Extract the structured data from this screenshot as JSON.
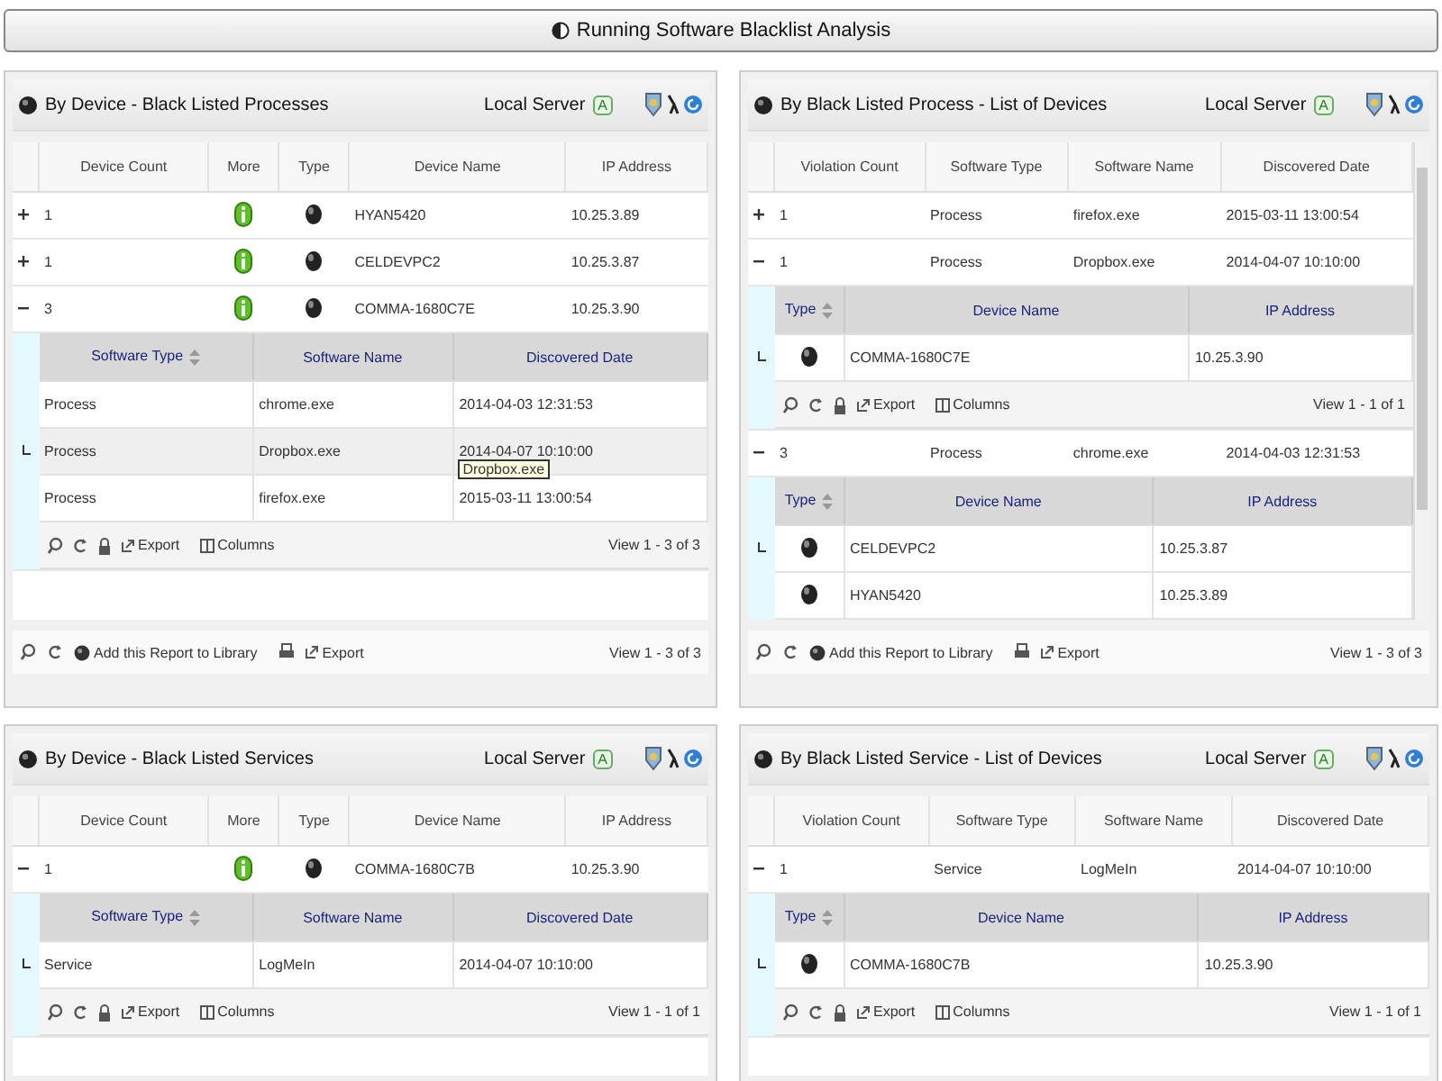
{
  "header": {
    "title": "Running Software Blacklist Analysis"
  },
  "panels": [
    {
      "title": "By Device - Black Listed Processes",
      "server": "Local Server",
      "server_badge": "A",
      "scrollable": false,
      "columns": [
        {
          "label": "Device Count",
          "kind": "text"
        },
        {
          "label": "More",
          "kind": "info"
        },
        {
          "label": "Type",
          "kind": "device"
        },
        {
          "label": "Device Name",
          "kind": "text"
        },
        {
          "label": "IP Address",
          "kind": "text"
        }
      ],
      "rows": [
        {
          "expanded": false,
          "cells": [
            "1",
            "",
            "",
            "HYAN5420",
            "10.25.3.89"
          ]
        },
        {
          "expanded": false,
          "cells": [
            "1",
            "",
            "",
            "CELDEVPC2",
            "10.25.3.87"
          ]
        },
        {
          "expanded": true,
          "cells": [
            "3",
            "",
            "",
            "COMMA-1680C7E",
            "10.25.3.90"
          ],
          "subgrid": {
            "columns": [
              {
                "label": "Software Type",
                "kind": "text",
                "sorted": true
              },
              {
                "label": "Software Name",
                "kind": "text",
                "sorted": false
              },
              {
                "label": "Discovered Date",
                "kind": "text",
                "sorted": false
              }
            ],
            "rows": [
              {
                "hovered": false,
                "cells": [
                  "Process",
                  "chrome.exe",
                  "2014-04-03 12:31:53"
                ]
              },
              {
                "hovered": true,
                "tooltip": "Dropbox.exe",
                "cells": [
                  "Process",
                  "Dropbox.exe",
                  "2014-04-07 10:10:00"
                ]
              },
              {
                "hovered": false,
                "cells": [
                  "Process",
                  "firefox.exe",
                  "2015-03-11 13:00:54"
                ]
              }
            ],
            "footer": {
              "export": "Export",
              "columns": "Columns",
              "pager": "View 1 - 3 of 3"
            }
          }
        }
      ],
      "footer": {
        "add": "Add this Report to Library",
        "export": "Export",
        "pager": "View 1 - 3 of 3"
      }
    },
    {
      "title": "By Black Listed Process - List of Devices",
      "server": "Local Server",
      "server_badge": "A",
      "scrollable": true,
      "columns": [
        {
          "label": "Violation Count",
          "kind": "text"
        },
        {
          "label": "Software Type",
          "kind": "text"
        },
        {
          "label": "Software Name",
          "kind": "text"
        },
        {
          "label": "Discovered Date",
          "kind": "text"
        }
      ],
      "rows": [
        {
          "expanded": false,
          "cells": [
            "1",
            "Process",
            "firefox.exe",
            "2015-03-11 13:00:54"
          ]
        },
        {
          "expanded": true,
          "cells": [
            "1",
            "Process",
            "Dropbox.exe",
            "2014-04-07 10:10:00"
          ],
          "subgrid": {
            "columns": [
              {
                "label": "Type",
                "kind": "device",
                "sorted": true
              },
              {
                "label": "Device Name",
                "kind": "text",
                "sorted": false
              },
              {
                "label": "IP Address",
                "kind": "text",
                "sorted": false
              }
            ],
            "rows": [
              {
                "hovered": false,
                "cells": [
                  "",
                  "COMMA-1680C7E",
                  "10.25.3.90"
                ]
              }
            ],
            "footer": {
              "export": "Export",
              "columns": "Columns",
              "pager": "View 1 - 1 of 1"
            }
          }
        },
        {
          "expanded": true,
          "cells": [
            "3",
            "Process",
            "chrome.exe",
            "2014-04-03 12:31:53"
          ],
          "subgrid": {
            "columns": [
              {
                "label": "Type",
                "kind": "device",
                "sorted": true
              },
              {
                "label": "Device Name",
                "kind": "text",
                "sorted": false
              },
              {
                "label": "IP Address",
                "kind": "text",
                "sorted": false
              }
            ],
            "rows": [
              {
                "hovered": false,
                "cells": [
                  "",
                  "CELDEVPC2",
                  "10.25.3.87"
                ]
              },
              {
                "hovered": false,
                "cells": [
                  "",
                  "HYAN5420",
                  "10.25.3.89"
                ]
              }
            ]
          }
        }
      ],
      "footer": {
        "add": "Add this Report to Library",
        "export": "Export",
        "pager": "View 1 - 3 of 3"
      }
    },
    {
      "title": "By Device - Black Listed Services",
      "server": "Local Server",
      "server_badge": "A",
      "scrollable": false,
      "columns": [
        {
          "label": "Device Count",
          "kind": "text"
        },
        {
          "label": "More",
          "kind": "info"
        },
        {
          "label": "Type",
          "kind": "device"
        },
        {
          "label": "Device Name",
          "kind": "text"
        },
        {
          "label": "IP Address",
          "kind": "text"
        }
      ],
      "rows": [
        {
          "expanded": true,
          "cells": [
            "1",
            "",
            "",
            "COMMA-1680C7B",
            "10.25.3.90"
          ],
          "subgrid": {
            "columns": [
              {
                "label": "Software Type",
                "kind": "text",
                "sorted": true
              },
              {
                "label": "Software Name",
                "kind": "text",
                "sorted": false
              },
              {
                "label": "Discovered Date",
                "kind": "text",
                "sorted": false
              }
            ],
            "rows": [
              {
                "hovered": false,
                "cells": [
                  "Service",
                  "LogMeIn",
                  "2014-04-07 10:10:00"
                ]
              }
            ],
            "footer": {
              "export": "Export",
              "columns": "Columns",
              "pager": "View 1 - 1 of 1"
            }
          }
        }
      ]
    },
    {
      "title": "By Black Listed Service - List of Devices",
      "server": "Local Server",
      "server_badge": "A",
      "scrollable": false,
      "columns": [
        {
          "label": "Violation Count",
          "kind": "text"
        },
        {
          "label": "Software Type",
          "kind": "text"
        },
        {
          "label": "Software Name",
          "kind": "text"
        },
        {
          "label": "Discovered Date",
          "kind": "text"
        }
      ],
      "rows": [
        {
          "expanded": true,
          "cells": [
            "1",
            "Service",
            "LogMeIn",
            "2014-04-07 10:10:00"
          ],
          "subgrid": {
            "columns": [
              {
                "label": "Type",
                "kind": "device",
                "sorted": true
              },
              {
                "label": "Device Name",
                "kind": "text",
                "sorted": false
              },
              {
                "label": "IP Address",
                "kind": "text",
                "sorted": false
              }
            ],
            "rows": [
              {
                "hovered": false,
                "cells": [
                  "",
                  "COMMA-1680C7B",
                  "10.25.3.90"
                ]
              }
            ],
            "footer": {
              "export": "Export",
              "columns": "Columns",
              "pager": "View 1 - 1 of 1"
            }
          }
        }
      ]
    }
  ]
}
